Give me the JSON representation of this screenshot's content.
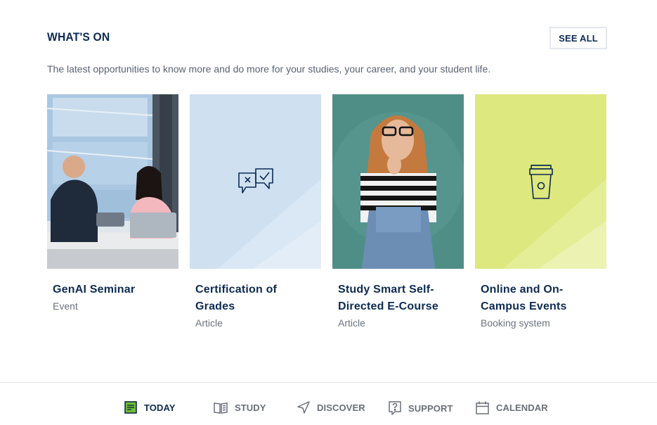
{
  "header": {
    "title": "WHAT'S ON",
    "see_all_label": "SEE ALL",
    "subtitle": "The latest opportunities to know more and do more for your studies, your career, and your student life."
  },
  "cards": [
    {
      "title": "GenAI Seminar",
      "type": "Event",
      "media": "photo-people-laptops"
    },
    {
      "title": "Certification of Grades",
      "type": "Article",
      "media": "speech-bubbles-icon",
      "bg": "#cfe0f0"
    },
    {
      "title": "Study Smart Self-Directed E-Course",
      "type": "Article",
      "media": "photo-student-glasses"
    },
    {
      "title": "Online and On-Campus Events",
      "type": "Booking system",
      "media": "coffee-cup-icon",
      "bg": "#dde87e"
    }
  ],
  "nav": [
    {
      "label": "TODAY",
      "icon": "note-icon",
      "active": true
    },
    {
      "label": "STUDY",
      "icon": "book-icon",
      "active": false
    },
    {
      "label": "DISCOVER",
      "icon": "navigation-arrow-icon",
      "active": false
    },
    {
      "label": "SUPPORT",
      "icon": "help-bubble-icon",
      "active": false
    },
    {
      "label": "CALENDAR",
      "icon": "calendar-icon",
      "active": false
    }
  ],
  "colors": {
    "primary": "#0d2b52",
    "active_icon_green": "#6fbf2a",
    "card_blue": "#cfe0f0",
    "card_lime": "#dde87e"
  }
}
